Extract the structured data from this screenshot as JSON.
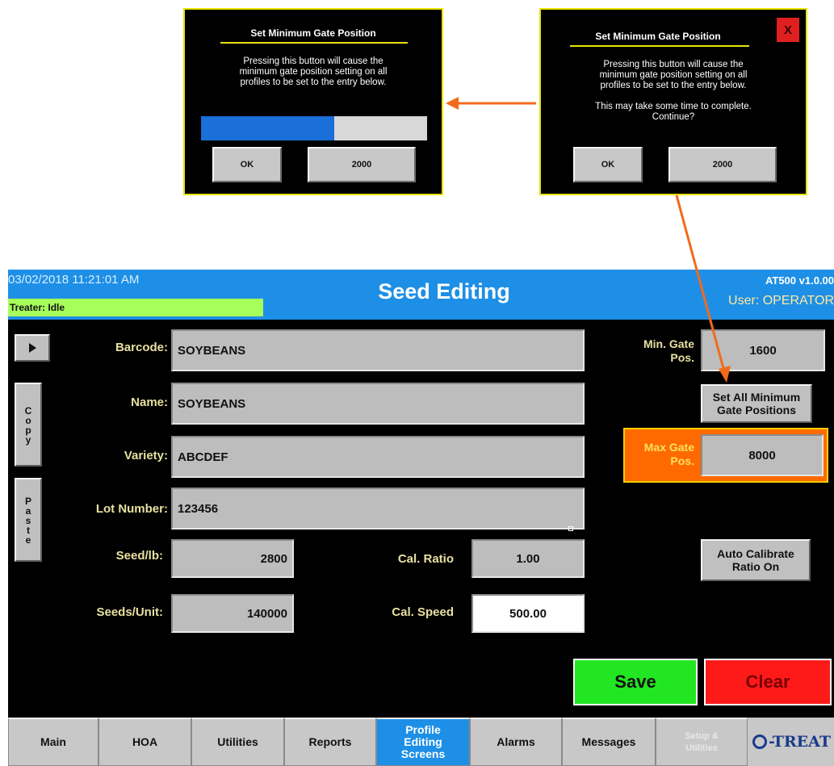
{
  "dialog_left": {
    "title": "Set Minimum Gate Position",
    "message": "Pressing this button will cause the\nminimum gate position setting on all\nprofiles to be set to the entry below.",
    "progress": 0.59,
    "ok_label": "OK",
    "value_label": "2000"
  },
  "dialog_right": {
    "title": "Set Minimum Gate Position",
    "close_label": "X",
    "message": "Pressing this button will cause the\nminimum gate position setting on all\nprofiles to be set to the entry below.\n\nThis may take some time to complete.\nContinue?",
    "ok_label": "OK",
    "value_label": "2000"
  },
  "header": {
    "datetime": "03/02/2018 11:21:01 AM",
    "title": "Seed Editing",
    "version": "AT500 v1.0.00",
    "user": "User: OPERATOR",
    "status": "Treater: Idle"
  },
  "side": {
    "copy": "Copy",
    "paste": "Paste"
  },
  "form": {
    "barcode_label": "Barcode:",
    "barcode_value": "SOYBEANS",
    "name_label": "Name:",
    "name_value": "SOYBEANS",
    "variety_label": "Variety:",
    "variety_value": "ABCDEF",
    "lot_label": "Lot Number:",
    "lot_value": "123456",
    "seedlb_label": "Seed/lb:",
    "seedlb_value": "2800",
    "seedsunit_label": "Seeds/Unit:",
    "seedsunit_value": "140000",
    "calratio_label": "Cal. Ratio",
    "calratio_value": "1.00",
    "calspeed_label": "Cal. Speed",
    "calspeed_value": "500.00"
  },
  "right": {
    "min_gate_label": "Min. Gate\nPos.",
    "min_gate_value": "1600",
    "set_all_label": "Set All Minimum\nGate Positions",
    "max_gate_label": "Max Gate\nPos.",
    "max_gate_value": "8000",
    "auto_cal_label": "Auto Calibrate\nRatio On"
  },
  "actions": {
    "save": "Save",
    "clear": "Clear"
  },
  "tabs": [
    "Main",
    "HOA",
    "Utilities",
    "Reports",
    "Profile\nEditing\nScreens",
    "Alarms",
    "Messages",
    "Setup &\nUtilities"
  ],
  "logo_text": "-TREAT",
  "colors": {
    "accent_blue": "#1e8fe6",
    "status_green": "#a6ff5a",
    "save_green": "#22e622",
    "clear_red": "#ff1a1a",
    "arrow_orange": "#f26a1b",
    "dialog_border": "#e8e400",
    "max_gate_orange": "#ff6a00"
  }
}
